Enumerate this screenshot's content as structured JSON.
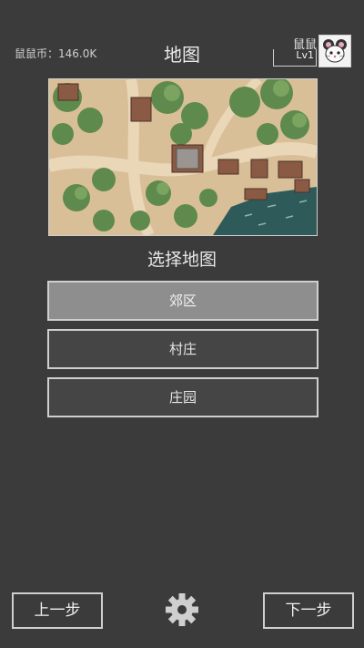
{
  "header": {
    "coins_text": "鼠鼠币：146.0K",
    "title": "地图",
    "player_name": "鼠鼠",
    "level_text": "Lv1",
    "avatar_icon": "mouse-avatar-icon"
  },
  "main": {
    "section_title": "选择地图",
    "options": [
      {
        "label": "郊区",
        "selected": true
      },
      {
        "label": "村庄",
        "selected": false
      },
      {
        "label": "庄园",
        "selected": false
      }
    ]
  },
  "footer": {
    "prev_label": "上一步",
    "next_label": "下一步",
    "settings_icon": "gear-icon"
  },
  "colors": {
    "background": "#3b3b3b",
    "selected_option": "#8e8e8e",
    "option": "#454545",
    "border": "#cfcfcf"
  }
}
